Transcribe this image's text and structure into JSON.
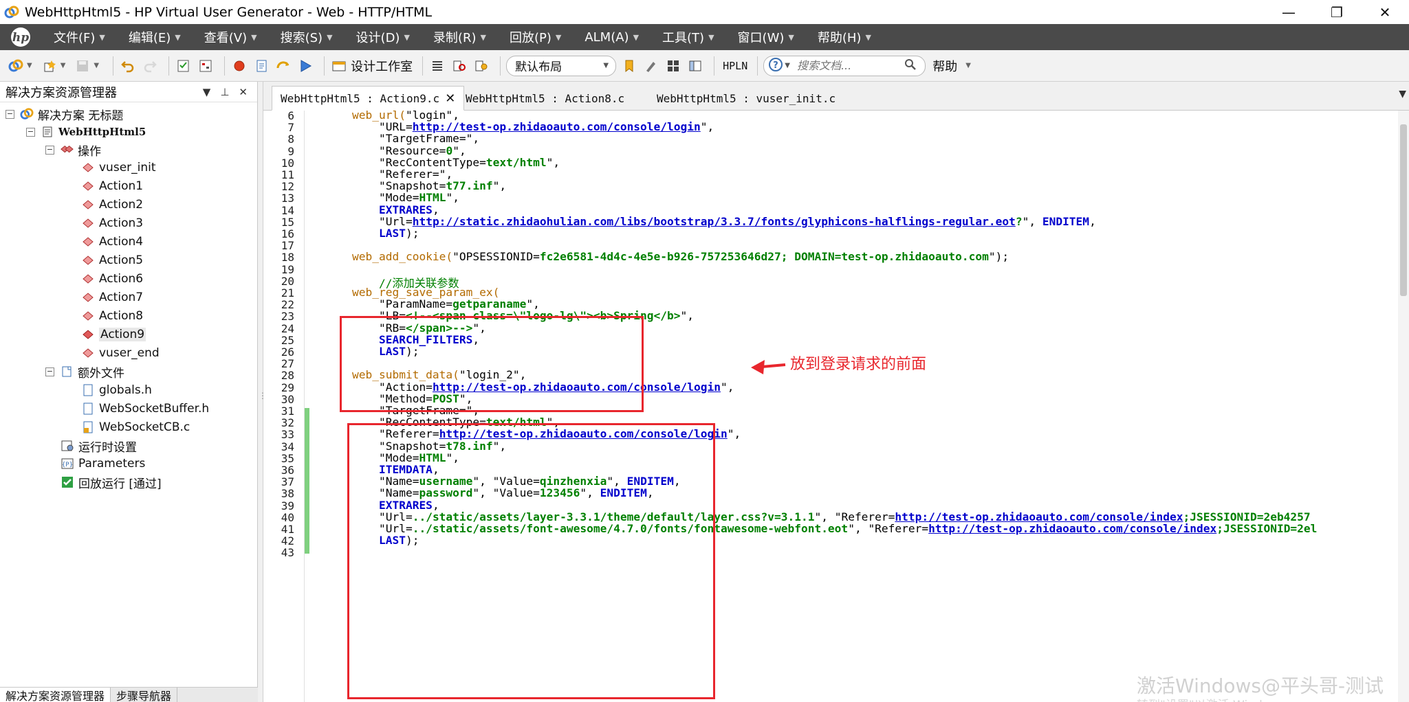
{
  "window": {
    "title": "WebHttpHtml5 - HP Virtual User Generator - Web - HTTP/HTML",
    "minimize": "—",
    "maximize": "❐",
    "close": "✕"
  },
  "menu": {
    "items": [
      "文件(F)",
      "编辑(E)",
      "查看(V)",
      "搜索(S)",
      "设计(D)",
      "录制(R)",
      "回放(P)",
      "ALM(A)",
      "工具(T)",
      "窗口(W)",
      "帮助(H)"
    ]
  },
  "toolbar": {
    "design_studio": "设计工作室",
    "layout_selected": "默认布局",
    "hpln": "HPLN",
    "search_placeholder": "搜索文档...",
    "help": "帮助"
  },
  "solution_explorer": {
    "title": "解决方案资源管理器",
    "solution": "解决方案 无标题",
    "script": "WebHttpHtml5",
    "actions_folder": "操作",
    "actions": [
      "vuser_init",
      "Action1",
      "Action2",
      "Action3",
      "Action4",
      "Action5",
      "Action6",
      "Action7",
      "Action8",
      "Action9",
      "vuser_end"
    ],
    "selected_action": "Action9",
    "extra_files_folder": "额外文件",
    "extra_files": [
      "globals.h",
      "WebSocketBuffer.h",
      "WebSocketCB.c"
    ],
    "runtime_settings": "运行时设置",
    "parameters": "Parameters",
    "replay_run": "回放运行 [通过]"
  },
  "bottom_tabs": [
    "解决方案资源管理器",
    "步骤导航器"
  ],
  "editor": {
    "tabs": [
      "WebHttpHtml5 : Action9.c",
      "WebHttpHtml5 : Action8.c",
      "WebHttpHtml5 : vuser_init.c"
    ],
    "active_tab": "WebHttpHtml5 : Action9.c",
    "line_numbers": [
      "6",
      "7",
      "8",
      "9",
      "10",
      "11",
      "12",
      "13",
      "14",
      "15",
      "16",
      "17",
      "18",
      "19",
      "20",
      "21",
      "22",
      "23",
      "24",
      "25",
      "26",
      "27",
      "28",
      "29",
      "30",
      "31",
      "32",
      "33",
      "34",
      "35",
      "36",
      "37",
      "38",
      "39",
      "40",
      "41",
      "42",
      "43"
    ],
    "lines": [
      [
        [
          "fn",
          "    web_url("
        ],
        [
          "str",
          "\"login\""
        ],
        [
          "pl",
          ",  "
        ]
      ],
      [
        [
          "str",
          "        \"URL="
        ],
        [
          "url",
          "http://test-op.zhidaoauto.com/console/login"
        ],
        [
          "str",
          "\""
        ],
        [
          "pl",
          ","
        ]
      ],
      [
        [
          "str",
          "        \"TargetFrame=\""
        ],
        [
          "pl",
          ","
        ]
      ],
      [
        [
          "str",
          "        \"Resource="
        ],
        [
          "val",
          "0"
        ],
        [
          "str",
          "\""
        ],
        [
          "pl",
          ","
        ]
      ],
      [
        [
          "str",
          "        \"RecContentType="
        ],
        [
          "val",
          "text/html"
        ],
        [
          "str",
          "\""
        ],
        [
          "pl",
          ","
        ]
      ],
      [
        [
          "str",
          "        \"Referer=\""
        ],
        [
          "pl",
          ","
        ]
      ],
      [
        [
          "str",
          "        \"Snapshot="
        ],
        [
          "val",
          "t77.inf"
        ],
        [
          "str",
          "\""
        ],
        [
          "pl",
          ","
        ]
      ],
      [
        [
          "str",
          "        \"Mode="
        ],
        [
          "val",
          "HTML"
        ],
        [
          "str",
          "\""
        ],
        [
          "pl",
          ","
        ]
      ],
      [
        [
          "kw",
          "        EXTRARES"
        ],
        [
          "pl",
          ","
        ]
      ],
      [
        [
          "str",
          "        \"Url="
        ],
        [
          "url",
          "http://static.zhidaohulian.com/libs/bootstrap/3.3.7/fonts/glyphicons-halflings-regular.eot"
        ],
        [
          "val",
          "?"
        ],
        [
          "str",
          "\""
        ],
        [
          "pl",
          ", "
        ],
        [
          "kw",
          "ENDITEM"
        ],
        [
          "pl",
          ","
        ]
      ],
      [
        [
          "kw",
          "        LAST"
        ],
        [
          "pl",
          ");"
        ]
      ],
      [
        [
          "pl",
          ""
        ]
      ],
      [
        [
          "fn",
          "    web_add_cookie("
        ],
        [
          "str",
          "\"OPSESSIONID="
        ],
        [
          "val",
          "fc2e6581-4d4c-4e5e-b926-757253646d27; DOMAIN=test-op.zhidaoauto.com"
        ],
        [
          "str",
          "\""
        ],
        [
          "pl",
          ");"
        ]
      ],
      [
        [
          "pl",
          ""
        ]
      ],
      [
        [
          "cm",
          "        //添加关联参数"
        ]
      ],
      [
        [
          "fn",
          "    web_reg_save_param_ex("
        ]
      ],
      [
        [
          "str",
          "        \"ParamName="
        ],
        [
          "val",
          "getparaname"
        ],
        [
          "str",
          "\""
        ],
        [
          "pl",
          ","
        ]
      ],
      [
        [
          "str",
          "        \"LB="
        ],
        [
          "val",
          "<!--<span class=\\\"logo-lg\\\"><b>Spring</b>"
        ],
        [
          "str",
          "\""
        ],
        [
          "pl",
          ","
        ]
      ],
      [
        [
          "str",
          "        \"RB="
        ],
        [
          "val",
          "</span>-->"
        ],
        [
          "str",
          "\""
        ],
        [
          "pl",
          ","
        ]
      ],
      [
        [
          "kw",
          "        SEARCH_FILTERS"
        ],
        [
          "pl",
          ","
        ]
      ],
      [
        [
          "kw",
          "        LAST"
        ],
        [
          "pl",
          ");"
        ]
      ],
      [
        [
          "pl",
          ""
        ]
      ],
      [
        [
          "fn",
          "    web_submit_data("
        ],
        [
          "str",
          "\"login_2\""
        ],
        [
          "pl",
          ","
        ]
      ],
      [
        [
          "str",
          "        \"Action="
        ],
        [
          "url",
          "http://test-op.zhidaoauto.com/console/login"
        ],
        [
          "str",
          "\""
        ],
        [
          "pl",
          ","
        ]
      ],
      [
        [
          "str",
          "        \"Method="
        ],
        [
          "val",
          "POST"
        ],
        [
          "str",
          "\""
        ],
        [
          "pl",
          ","
        ]
      ],
      [
        [
          "str",
          "        \"TargetFrame=\""
        ],
        [
          "pl",
          ","
        ]
      ],
      [
        [
          "str",
          "        \"RecContentType="
        ],
        [
          "val",
          "text/html"
        ],
        [
          "str",
          "\""
        ],
        [
          "pl",
          ","
        ]
      ],
      [
        [
          "str",
          "        \"Referer="
        ],
        [
          "url",
          "http://test-op.zhidaoauto.com/console/login"
        ],
        [
          "str",
          "\""
        ],
        [
          "pl",
          ","
        ]
      ],
      [
        [
          "str",
          "        \"Snapshot="
        ],
        [
          "val",
          "t78.inf"
        ],
        [
          "str",
          "\""
        ],
        [
          "pl",
          ","
        ]
      ],
      [
        [
          "str",
          "        \"Mode="
        ],
        [
          "val",
          "HTML"
        ],
        [
          "str",
          "\""
        ],
        [
          "pl",
          ","
        ]
      ],
      [
        [
          "kw",
          "        ITEMDATA"
        ],
        [
          "pl",
          ","
        ]
      ],
      [
        [
          "str",
          "        \"Name="
        ],
        [
          "val",
          "username"
        ],
        [
          "str",
          "\""
        ],
        [
          "pl",
          ", "
        ],
        [
          "str",
          "\"Value="
        ],
        [
          "val",
          "qinzhenxia"
        ],
        [
          "str",
          "\""
        ],
        [
          "pl",
          ", "
        ],
        [
          "kw",
          "ENDITEM"
        ],
        [
          "pl",
          ","
        ]
      ],
      [
        [
          "str",
          "        \"Name="
        ],
        [
          "val",
          "password"
        ],
        [
          "str",
          "\""
        ],
        [
          "pl",
          ", "
        ],
        [
          "str",
          "\"Value="
        ],
        [
          "val",
          "123456"
        ],
        [
          "str",
          "\""
        ],
        [
          "pl",
          ", "
        ],
        [
          "kw",
          "ENDITEM"
        ],
        [
          "pl",
          ","
        ]
      ],
      [
        [
          "kw",
          "        EXTRARES"
        ],
        [
          "pl",
          ","
        ]
      ],
      [
        [
          "str",
          "        \"Url="
        ],
        [
          "val",
          "../static/assets/layer-3.3.1/theme/default/layer.css?v=3.1.1"
        ],
        [
          "str",
          "\""
        ],
        [
          "pl",
          ", "
        ],
        [
          "str",
          "\"Referer="
        ],
        [
          "url",
          "http://test-op.zhidaoauto.com/console/index"
        ],
        [
          "val",
          ";JSESSIONID=2eb4257"
        ]
      ],
      [
        [
          "str",
          "        \"Url="
        ],
        [
          "val",
          "../static/assets/font-awesome/4.7.0/fonts/fontawesome-webfont.eot"
        ],
        [
          "str",
          "\""
        ],
        [
          "pl",
          ", "
        ],
        [
          "str",
          "\"Referer="
        ],
        [
          "url",
          "http://test-op.zhidaoauto.com/console/index"
        ],
        [
          "val",
          ";JSESSIONID=2el"
        ]
      ],
      [
        [
          "kw",
          "        LAST"
        ],
        [
          "pl",
          ");"
        ]
      ],
      [
        [
          "pl",
          ""
        ]
      ]
    ]
  },
  "annotation": "放到登录请求的前面",
  "watermark": "激活Windows@平头哥-测试",
  "watermark_sub": "转到\"设置\"以激活 Windows。"
}
